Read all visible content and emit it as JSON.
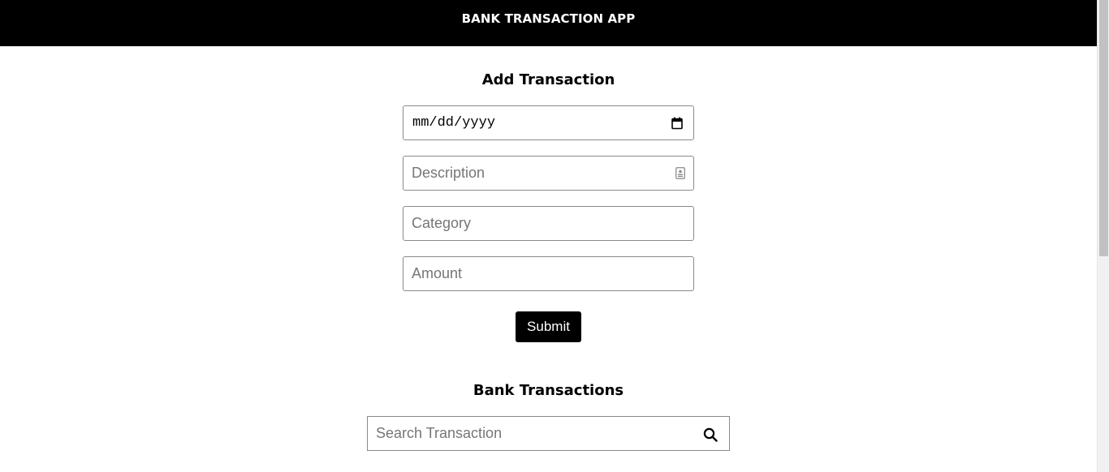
{
  "header": {
    "title": "BANK TRANSACTION APP"
  },
  "add_form": {
    "title": "Add Transaction",
    "date_placeholder": "mm/dd/yyyy",
    "description_placeholder": "Description",
    "category_placeholder": "Category",
    "amount_placeholder": "Amount",
    "submit_label": "Submit"
  },
  "transactions": {
    "title": "Bank Transactions",
    "search_placeholder": "Search Transaction"
  },
  "icons": {
    "date": "calendar-icon",
    "description": "contact-card-icon",
    "search": "search-icon"
  },
  "colors": {
    "header_bg": "#000000",
    "header_text": "#ffffff",
    "button_bg": "#000000",
    "button_text": "#ffffff"
  }
}
